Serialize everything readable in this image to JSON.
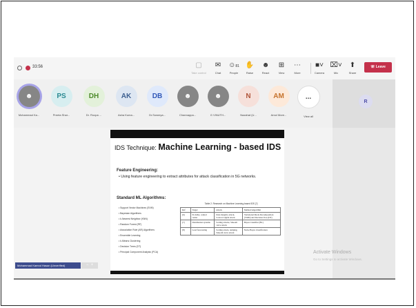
{
  "toolbar": {
    "timer": "33:56",
    "buttons": [
      {
        "label": "Take control",
        "icon": "take-control-icon"
      },
      {
        "label": "Chat",
        "icon": "chat-icon"
      },
      {
        "label": "People",
        "icon": "people-icon",
        "badge": "81"
      },
      {
        "label": "Raise",
        "icon": "raise-hand-icon"
      },
      {
        "label": "React",
        "icon": "react-icon"
      },
      {
        "label": "View",
        "icon": "view-icon"
      },
      {
        "label": "More",
        "icon": "more-icon"
      },
      {
        "label": "Camera",
        "icon": "camera-icon"
      },
      {
        "label": "Mic",
        "icon": "mic-icon"
      },
      {
        "label": "Share",
        "icon": "share-icon"
      }
    ],
    "leave_label": "Leave",
    "leave_color": "#c4314b"
  },
  "participants": [
    {
      "initials": "",
      "name": "Mohammad Ka..."
    },
    {
      "initials": "PS",
      "name": "Preeta Shar..."
    },
    {
      "initials": "DH",
      "name": "Dr. Roopa ..."
    },
    {
      "initials": "AK",
      "name": "Asha Kuma..."
    },
    {
      "initials": "DB",
      "name": "Dr.Sowmya..."
    },
    {
      "initials": "",
      "name": "Channappa..."
    },
    {
      "initials": "",
      "name": "G VINUTH..."
    },
    {
      "initials": "N",
      "name": "Nazahat (U..."
    },
    {
      "initials": "AM",
      "name": "Amol More..."
    },
    {
      "initials": "...",
      "name": "View all"
    }
  ],
  "side_tile": {
    "initials": "R"
  },
  "slide": {
    "title_prefix": "IDS Technique: ",
    "title_main": "Machine Learning - based IDS",
    "feature_heading": "Feature Engineering:",
    "feature_line": "Using feature engineering to extract attributes for attack classification in 5G networks.",
    "algorithms_heading": "Standard ML Algorithms:",
    "algorithms": [
      "Support Vector Machines (SVM)",
      "Bayesian Algorithms",
      "k-Nearest Neighbor (KNN)",
      "Random Forest (RF)",
      "Association Rule (AR) Algorithms",
      "Ensemble Learning",
      "k-Means Clustering",
      "Decision Trees (DT)",
      "Principal Component Analysis (PCA)"
    ],
    "table_caption": "Table 2. Research on Machine Learning-based IDS [?]",
    "table_headers": [
      "Ref",
      "Target",
      "Attack",
      "Method/Algorithm"
    ],
    "table_rows": [
      [
        "[6]",
        "SCADA, control center",
        "Data integrity attack, Cont.rol signal attack",
        "Variational Mode Decomposition (VMD) and Decision Tree (DT)"
      ],
      [
        "[7]",
        "Distribution systems",
        "Scaling attacks, Smooth curve attack",
        "Bayes Classifier (BC)"
      ],
      [
        "[8]",
        "Load forecasting",
        "Scaling attack, ramping, Smooth curve attack",
        "Naive Bayes classification"
      ]
    ]
  },
  "activation": {
    "title": "Activate Windows",
    "subtitle": "Go to Settings to activate Windows."
  },
  "presenter_tag": "Mohammad Kamrul Hasan (Unverified)"
}
